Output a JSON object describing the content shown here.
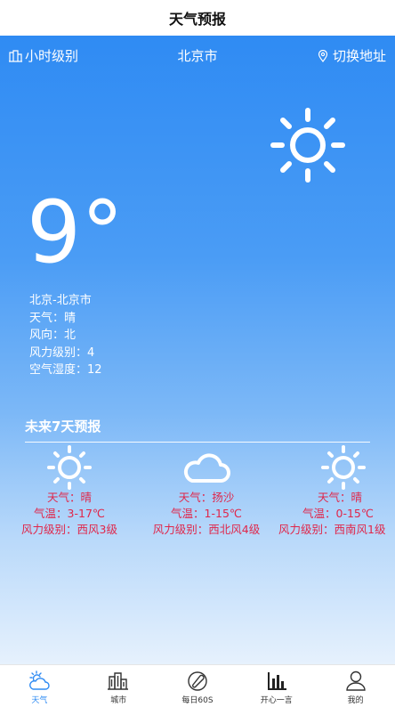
{
  "app": {
    "title": "天气预报"
  },
  "header": {
    "hourly_label": "小时级别",
    "city": "北京市",
    "switch_label": "切换地址"
  },
  "current": {
    "temperature": "9°",
    "location": "北京-北京市",
    "weather": "天气：晴",
    "wind_direction": "风向：北",
    "wind_level": "风力级别：4",
    "humidity": "空气湿度：12",
    "icon": "sun-icon"
  },
  "forecast": {
    "title": "未来7天预报",
    "days": [
      {
        "weather": "天气：晴",
        "temp": "气温：3-17℃",
        "wind": "风力级别：西风3级",
        "icon": "sun-icon"
      },
      {
        "weather": "天气：扬沙",
        "temp": "气温：1-15℃",
        "wind": "风力级别：西北风4级",
        "icon": "cloud-icon"
      },
      {
        "weather": "天气：晴",
        "temp": "气温：0-15℃",
        "wind": "风力级别：西南风1级",
        "icon": "sun-icon"
      }
    ]
  },
  "tabs": [
    {
      "label": "天气",
      "icon": "weather-icon",
      "active": true
    },
    {
      "label": "城市",
      "icon": "city-icon",
      "active": false
    },
    {
      "label": "每日60S",
      "icon": "news-icon",
      "active": false
    },
    {
      "label": "开心一言",
      "icon": "chart-icon",
      "active": false
    },
    {
      "label": "我的",
      "icon": "user-icon",
      "active": false
    }
  ],
  "colors": {
    "accent": "#2f8bf3",
    "forecast_text": "#e0264a",
    "text_on_blue": "#ffffff"
  }
}
